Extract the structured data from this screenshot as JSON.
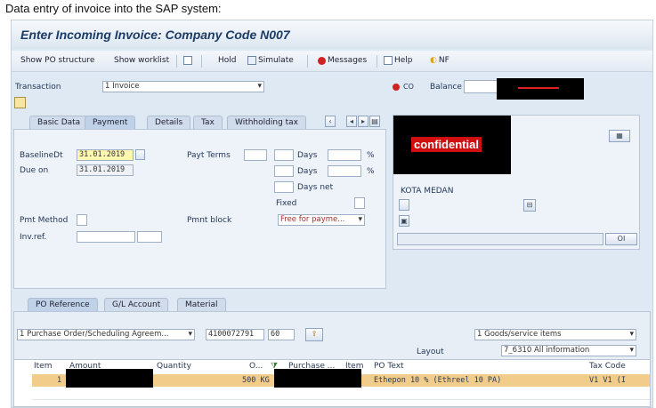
{
  "caption": "Data entry of invoice into the SAP system:",
  "window": {
    "title": "Enter Incoming Invoice: Company Code N007"
  },
  "toolbar": {
    "show_po_structure": "Show PO structure",
    "show_worklist": "Show worklist",
    "hold": "Hold",
    "simulate": "Simulate",
    "messages": "Messages",
    "help": "Help",
    "nf": "NF"
  },
  "header": {
    "transaction_label": "Transaction",
    "transaction_value": "1 Invoice",
    "balance_label": "Balance"
  },
  "tabs": [
    "Basic Data",
    "Payment",
    "Details",
    "Tax",
    "Withholding tax"
  ],
  "payment": {
    "baseline_label": "BaselineDt",
    "baseline_value": "31.01.2019",
    "due_label": "Due on",
    "due_value": "31.01.2019",
    "payt_terms_label": "Payt Terms",
    "days1": "Days",
    "days2": "Days",
    "days_net": "Days net",
    "pct1": "%",
    "pct2": "%",
    "fixed": "Fixed",
    "pmt_method_label": "Pmt Method",
    "pmnt_block_label": "Pmnt block",
    "pmnt_block_value": "Free for payme...",
    "invref_label": "Inv.ref."
  },
  "vendor": {
    "confidential": "confidential",
    "city": "KOTA MEDAN",
    "oi": "OI"
  },
  "bottom_tabs": [
    "PO Reference",
    "G/L Account",
    "Material"
  ],
  "po_ref": {
    "type_value": "1 Purchase Order/Scheduling Agreem...",
    "po_number": "4100072791",
    "item_short": "60",
    "goods_value": "1 Goods/service items",
    "layout_label": "Layout",
    "layout_value": "7_6310 All information"
  },
  "grid": {
    "headers": [
      "Item",
      "Amount",
      "Quantity",
      "O...",
      "Purchase ...",
      "Item",
      "PO Text",
      "Tax Code"
    ],
    "row": {
      "item": "1",
      "quantity": "500 KG",
      "po_text": "Ethepon 10 % (Ethreel 10 PA)",
      "tax_code": "V1 V1 (I"
    }
  }
}
